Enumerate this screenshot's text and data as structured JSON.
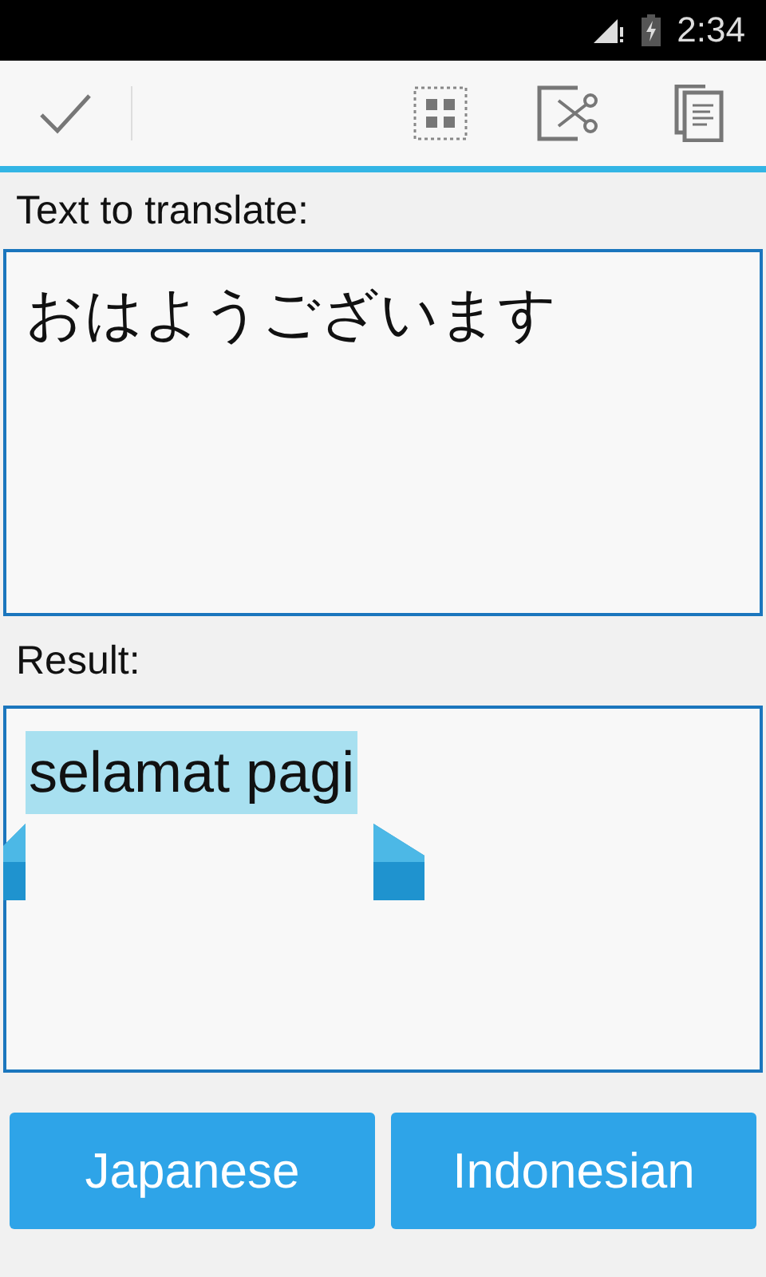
{
  "status_bar": {
    "time": "2:34"
  },
  "source": {
    "label": "Text to translate:",
    "value": "おはようございます"
  },
  "result": {
    "label": "Result:",
    "value": "selamat pagi",
    "selected": true
  },
  "buttons": [
    {
      "label": "Japanese"
    },
    {
      "label": "Indonesian"
    }
  ]
}
